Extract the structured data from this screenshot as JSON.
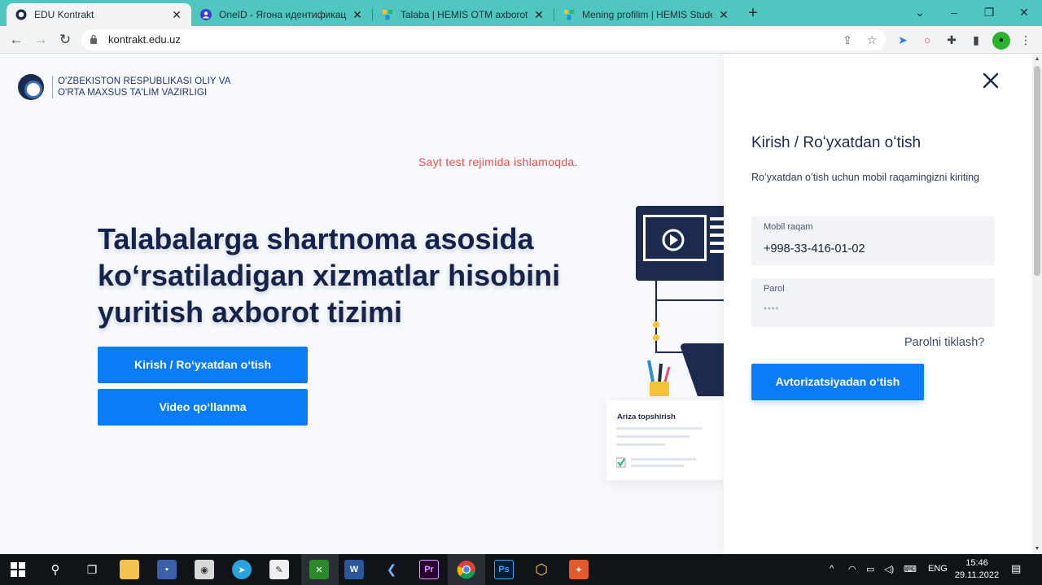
{
  "browser": {
    "tabs": [
      {
        "title": "EDU Kontrakt",
        "active": true
      },
      {
        "title": "OneID - Ягона идентификация т",
        "active": false
      },
      {
        "title": "Talaba | HEMIS OTM axborot tizir",
        "active": false
      },
      {
        "title": "Mening profilim | HEMIS Student",
        "active": false
      }
    ],
    "new_tab": "+",
    "url": "kontrakt.edu.uz"
  },
  "header": {
    "ministry_line1": "O'ZBEKISTON RESPUBLIKASI OLIY VA",
    "ministry_line2": "O'RTA MAXSUS TA'LIM VAZIRLIGI"
  },
  "notice": "Sayt test rejimida ishlamoqda.",
  "hero": {
    "title": "Talabalarga shartnoma asosida koʻrsatiladigan xizmatlar hisobini yuritish axborot tizimi",
    "login_button": "Kirish / Roʻyxatdan oʻtish",
    "video_button": "Video qoʻllanma"
  },
  "illustration": {
    "card_title": "Ariza topshirish"
  },
  "panel": {
    "title": "Kirish / Roʻyxatdan oʻtish",
    "subtitle": "Roʻyxatdan oʻtish uchun mobil raqamingizni kiriting",
    "phone_label": "Mobil raqam",
    "phone_value": "+998-33-416-01-02",
    "password_label": "Parol",
    "password_value": "****",
    "forgot_link": "Parolni tiklash?",
    "submit_button": "Avtorizatsiyadan oʻtish"
  },
  "taskbar": {
    "language": "ENG",
    "time": "15:46",
    "date": "29.11.2022"
  },
  "colors": {
    "primary": "#0a7cf5",
    "navy": "#15234a",
    "notice": "#f04b45",
    "tabstrip": "#4fc7c0"
  }
}
